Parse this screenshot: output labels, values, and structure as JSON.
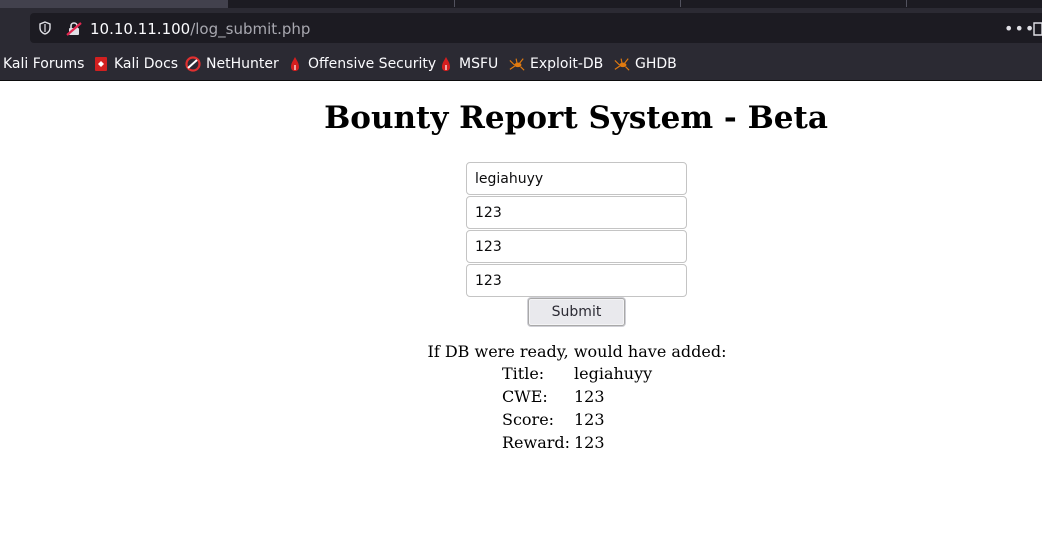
{
  "browser": {
    "url_host": "10.10.11.100",
    "url_path": "/log_submit.php",
    "bookmarks": [
      {
        "label": "Kali Forums",
        "icon": "kali-forums-icon"
      },
      {
        "label": "Kali Docs",
        "icon": "kali-docs-icon"
      },
      {
        "label": "NetHunter",
        "icon": "nethunter-icon"
      },
      {
        "label": "Offensive Security",
        "icon": "offsec-icon"
      },
      {
        "label": "MSFU",
        "icon": "msfu-icon"
      },
      {
        "label": "Exploit-DB",
        "icon": "exploit-db-icon"
      },
      {
        "label": "GHDB",
        "icon": "ghdb-icon"
      }
    ],
    "colors": {
      "chrome_dark": "#1c1b22",
      "chrome": "#2b2a33",
      "urlbar": "#1c1b22"
    }
  },
  "page": {
    "title": "Bounty Report System - Beta",
    "form": {
      "title_value": "legiahuyy",
      "cwe_value": "123",
      "score_value": "123",
      "reward_value": "123",
      "submit_label": "Submit"
    },
    "result": {
      "intro": "If DB were ready, would have added:",
      "rows": [
        {
          "label": "Title:",
          "value": "legiahuyy"
        },
        {
          "label": "CWE:",
          "value": "123"
        },
        {
          "label": "Score:",
          "value": "123"
        },
        {
          "label": "Reward:",
          "value": "123"
        }
      ]
    }
  }
}
